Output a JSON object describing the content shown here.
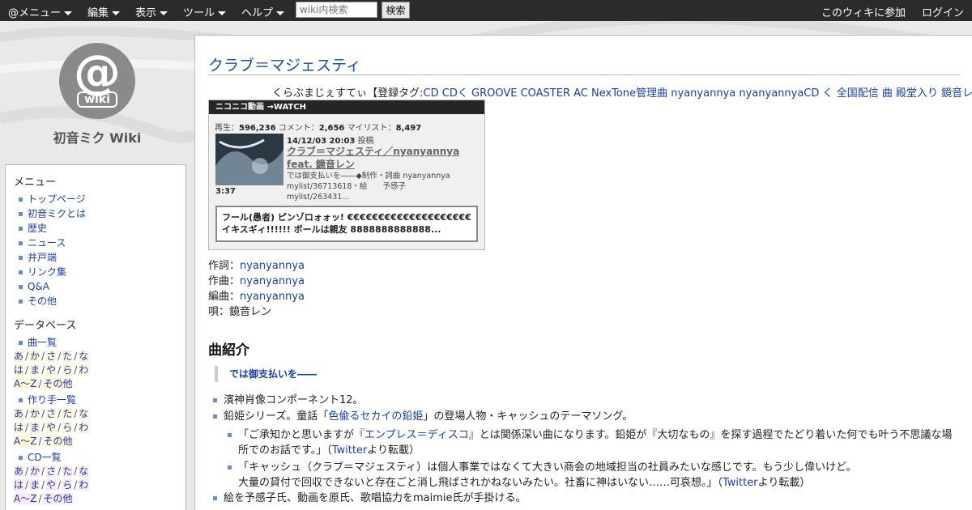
{
  "topbar": {
    "menus": [
      "@メニュー",
      "編集",
      "表示",
      "ツール",
      "ヘルプ"
    ],
    "search_placeholder": "wiki内検索",
    "search_button": "検索",
    "join": "このウィキに参加",
    "login": "ログイン"
  },
  "sidebar": {
    "logo_at": "@",
    "logo_wiki": "wiki",
    "site_name": "初音ミク Wiki",
    "menu_heading": "メニュー",
    "menu_items": [
      "トップページ",
      "初音ミクとは",
      "歴史",
      "ニュース",
      "井戸端",
      "リンク集",
      "Q&A",
      "その他"
    ],
    "db_heading": "データベース",
    "db_groups": [
      {
        "label": "曲一覧",
        "rows": [
          [
            "あ",
            "か",
            "さ",
            "た",
            "な"
          ],
          [
            "は",
            "ま",
            "や",
            "ら",
            "わ"
          ],
          [
            "A～Z",
            "その他"
          ]
        ]
      },
      {
        "label": "作り手一覧",
        "rows": [
          [
            "あ",
            "か",
            "さ",
            "た",
            "な"
          ],
          [
            "は",
            "ま",
            "や",
            "ら",
            "わ"
          ],
          [
            "A～Z",
            "その他"
          ]
        ]
      },
      {
        "label": "CD一覧",
        "rows": [
          [
            "あ",
            "か",
            "さ",
            "た",
            "な"
          ],
          [
            "は",
            "ま",
            "や",
            "ら",
            "わ"
          ],
          [
            "A～Z",
            "その他"
          ]
        ]
      }
    ]
  },
  "page": {
    "title": "クラブ＝マジェスティ",
    "reading": "くらぶまじぇすてぃ",
    "tags_prefix": "【登録タグ:",
    "tags": [
      "CD",
      "CDく",
      "GROOVE COASTER AC",
      "NexTone管理曲",
      "nyanyannya",
      "nyanyannyaCD",
      "く",
      "全国配信",
      "曲",
      "殿堂入り",
      "鏡音レン"
    ],
    "tags_suffix": "】"
  },
  "nico": {
    "bar_label": "ニコニコ動画 →WATCH",
    "play_label": "再生：",
    "plays": "596,236",
    "comment_label": "コメント：",
    "comments": "2,656",
    "mylist_label": "マイリスト：",
    "mylists": "8,497",
    "posted_date": "14/12/03 20:03",
    "posted_suffix": "投稿",
    "duration": "3:37",
    "video_title": "クラブ＝マジェスティ／nyanyannya feat. 鏡音レン",
    "description": "では御支払いを――◆制作・詞曲 nyanyannya　mylist/36713618・絵　　予感子　　mylist/263431...",
    "top_comment": "フール(愚者) ピンゾロォォッ! €€€€€€€€€€€€€€€€€€€€ イキスギィ!!!!!! ボールは親友 8888888888888..."
  },
  "credits": [
    {
      "label": "作詞：",
      "value": "nyanyannya",
      "link": true
    },
    {
      "label": "作曲：",
      "value": "nyanyannya",
      "link": true
    },
    {
      "label": "編曲：",
      "value": "nyanyannya",
      "link": true
    },
    {
      "label": "唄：",
      "value": "鏡音レン",
      "link": false
    }
  ],
  "section": {
    "heading": "曲紹介",
    "quote": "では御支払いを――",
    "b1": "濱神肖像コンポーネント12。",
    "b2_pre": "鉛姫シリーズ。童話「",
    "b2_link": "色偸るセカイの鉛姫",
    "b2_post": "」の登場人物・キャッシュのテーマソング。",
    "b3_pre": "「ご承知かと思いますが『",
    "b3_link": "エンプレス＝ディスコ",
    "b3_mid": "』とは関係深い曲になります。鉛姫が『大切なもの』を探す過程でたどり着いた何でも叶う不思議な場",
    "b3_line2_pre": "所でのお話です。」（",
    "b3_twitter": "Twitter",
    "b3_line2_post": "より転載）",
    "b4_line1": "「キャッシュ（クラブ＝マジェスティ）は個人事業ではなくて大きい商会の地域担当の社員みたいな感じです。もう少し偉いけど。",
    "b4_line2_pre": "大量の貸付で回収できないと存在ごと消し飛ばされかねないみたい。社畜に神はいない……可哀想。」（",
    "b4_twitter": "Twitter",
    "b4_line2_post": "より転載）",
    "b5": "絵を予感子氏、動画を原氏、歌唱協力をmaimie氏が手掛ける。"
  }
}
